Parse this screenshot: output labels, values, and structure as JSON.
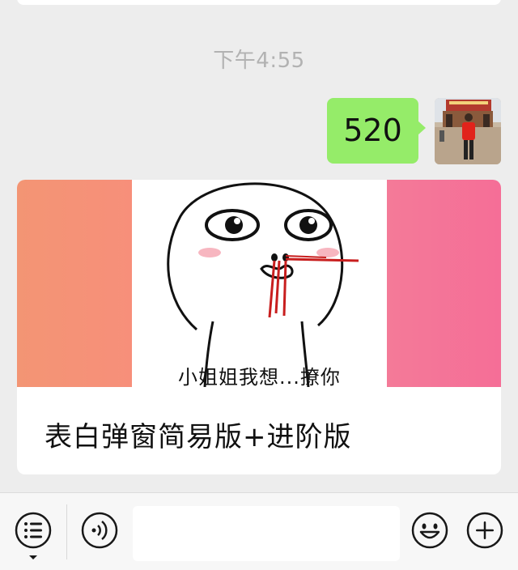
{
  "conversation": {
    "timestamp": "下午4:55",
    "sent_message": {
      "text": "520"
    },
    "link_card": {
      "meme_caption": "小姐姐我想...撩你",
      "title": "表白弹窗简易版+进阶版"
    }
  },
  "input_bar": {
    "menu_icon": "menu-list-icon",
    "voice_icon": "voice-icon",
    "emoji_icon": "emoji-icon",
    "plus_icon": "plus-icon",
    "message_value": ""
  },
  "colors": {
    "background": "#ededed",
    "sent_bubble": "#95ec69",
    "card_left": "#f39574",
    "card_right": "#f56e97"
  }
}
